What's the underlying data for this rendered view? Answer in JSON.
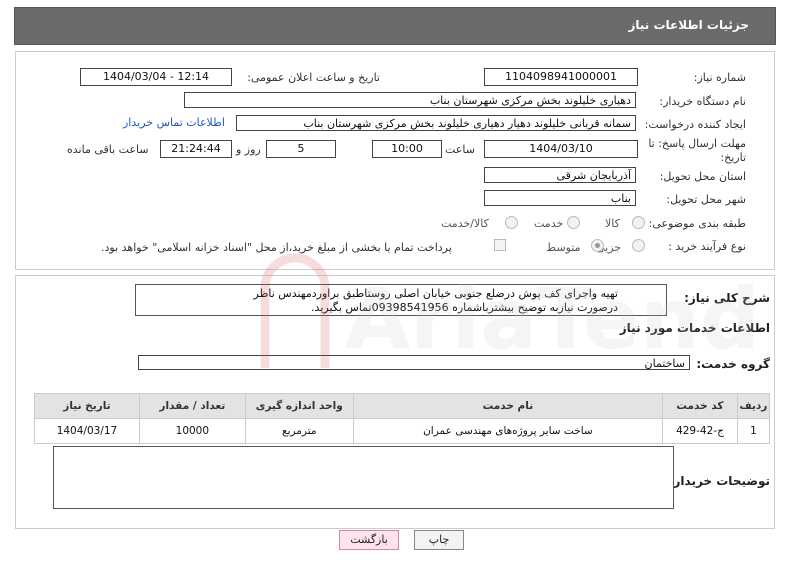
{
  "header": {
    "title": "جزئیات اطلاعات نیاز"
  },
  "form": {
    "need_number": {
      "label": "شماره نیاز:",
      "value": "1104098941000001"
    },
    "announce": {
      "label": "تاریخ و ساعت اعلان عمومی:",
      "value": "1404/03/04 - 12:14"
    },
    "buyer_org": {
      "label": "نام دستگاه خریدار:",
      "value": "دهیاری خلیلوند بخش مرکزی شهرستان بناب"
    },
    "creator": {
      "label": "ایجاد کننده درخواست:",
      "value": "سمانه قربانی خلیلوند دهیار دهیاری خلیلوند بخش مرکزی شهرستان بناب",
      "contact_link": "اطلاعات تماس خریدار"
    },
    "deadline": {
      "label_line1": "مهلت ارسال پاسخ: تا",
      "label_line2": "تاریخ:",
      "date": "1404/03/10",
      "time_label": "ساعت",
      "time": "10:00",
      "days": "5",
      "days_label": "روز و",
      "remaining": "21:24:44",
      "remaining_label": "ساعت باقی مانده"
    },
    "province": {
      "label": "استان محل تحویل:",
      "value": "آذربایجان شرقی"
    },
    "city": {
      "label": "شهر محل تحویل:",
      "value": "بناب"
    },
    "category": {
      "label": "طبقه بندی موضوعی:",
      "options": [
        "کالا",
        "خدمت",
        "کالا/خدمت"
      ],
      "selected": ""
    },
    "purchase_type": {
      "label": "نوع فرآیند خرید :",
      "options": [
        "جزیی",
        "متوسط"
      ],
      "selected": "متوسط",
      "payment_note": "پرداخت تمام یا بخشی از مبلغ خرید،از محل \"اسناد خزانه اسلامی\" خواهد بود."
    }
  },
  "summary": {
    "label": "شرح کلی نیاز:",
    "line1": "تهیه واجرای کف پوش درضلع جنوبی خیابان اصلی روستاطبق براوردمهندس ناظر",
    "line2": "درصورت نیازبه توضیح بیشترباشماره 09398541956تماس بگیرید."
  },
  "services": {
    "section_title": "اطلاعات خدمات مورد نیاز",
    "group_label": "گروه خدمت:",
    "group_value": "ساختمان",
    "table": {
      "columns": [
        "ردیف",
        "کد خدمت",
        "نام خدمت",
        "واحد اندازه گیری",
        "تعداد / مقدار",
        "تاریخ نیاز"
      ],
      "rows": [
        [
          "1",
          "ج-42-429",
          "ساخت سایر پروژه‌های مهندسی عمران",
          "مترمربع",
          "10000",
          "1404/03/17"
        ]
      ]
    }
  },
  "buyer_notes": {
    "label": "توضیحات خریدار:"
  },
  "buttons": {
    "print": "چاپ",
    "back": "بازگشت"
  },
  "watermark": {
    "text": "AriaTender.neT"
  }
}
